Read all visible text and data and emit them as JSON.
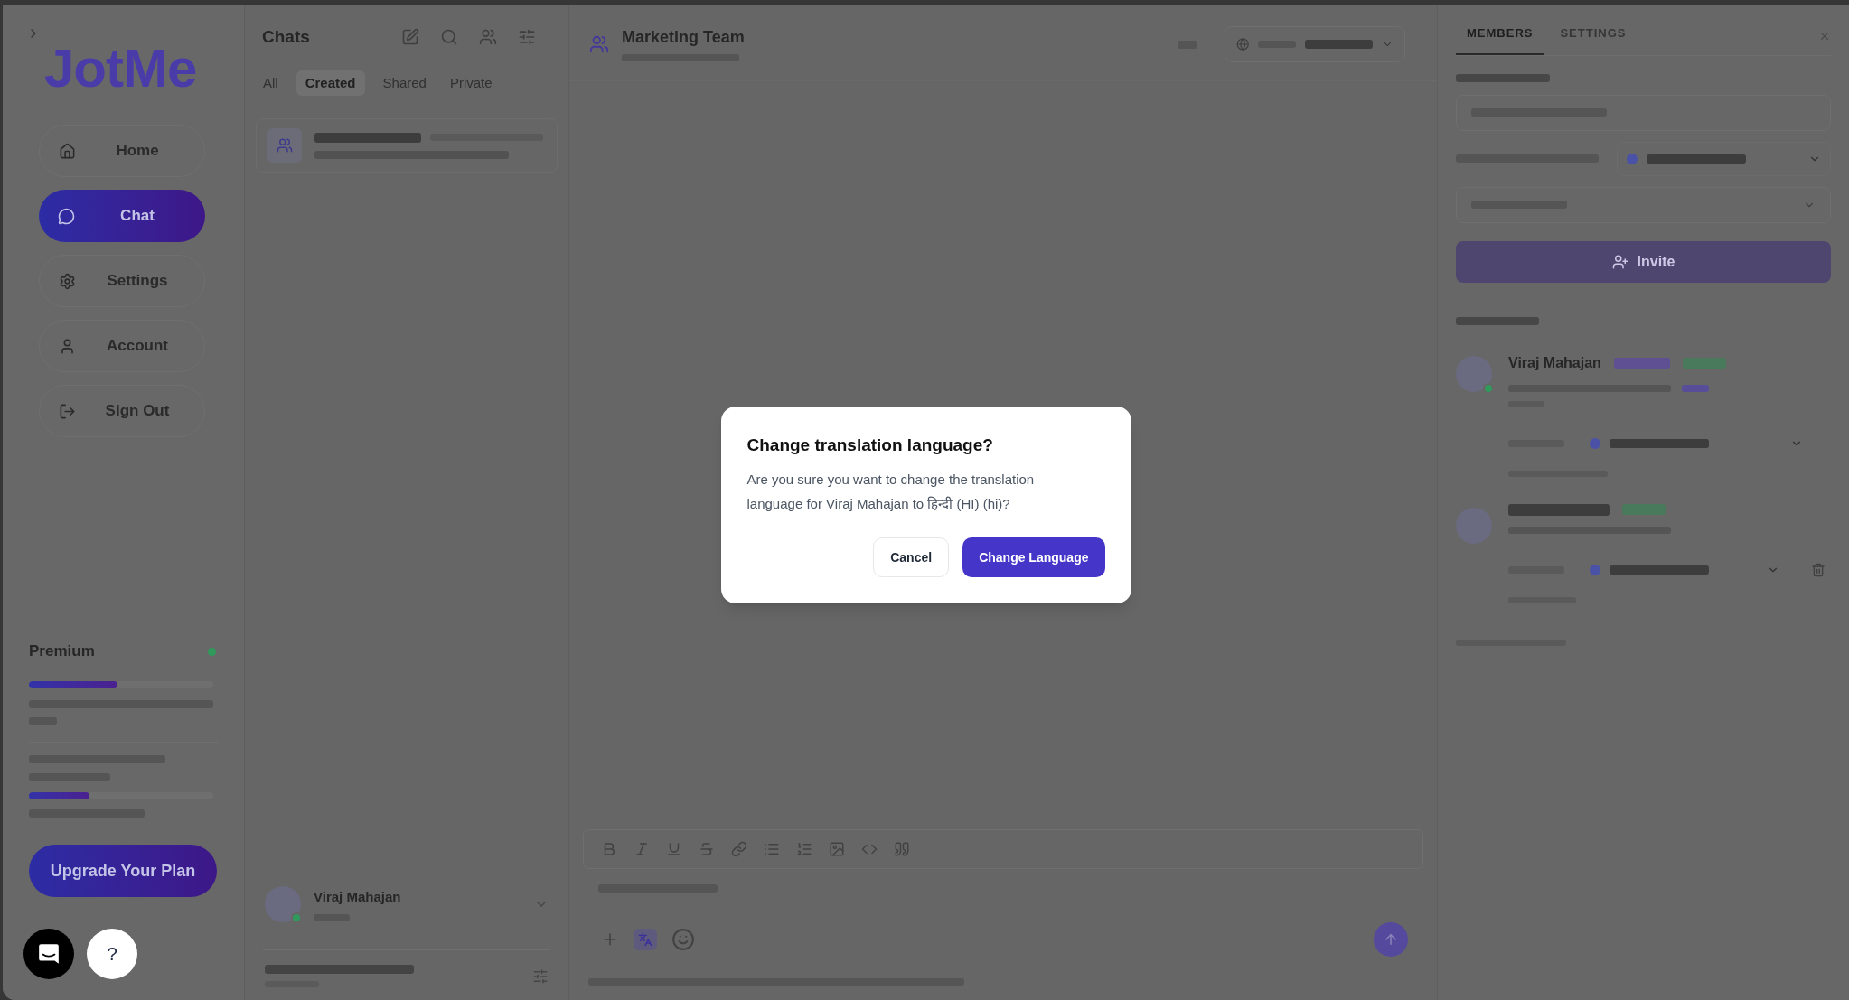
{
  "sidebar": {
    "logo": "JotMe",
    "nav": [
      {
        "label": "Home",
        "selected": false
      },
      {
        "label": "Chat",
        "selected": true
      },
      {
        "label": "Settings",
        "selected": false
      },
      {
        "label": "Account",
        "selected": false
      },
      {
        "label": "Sign Out",
        "selected": false
      }
    ],
    "plan": {
      "title": "Premium",
      "meters": [
        {
          "level": 0.48
        },
        {
          "level": 0.33
        }
      ],
      "upgrade_button": "Upgrade Your Plan"
    }
  },
  "chat_list": {
    "title": "Chats",
    "tabs": [
      {
        "label": "All",
        "selected": false
      },
      {
        "label": "Created",
        "selected": true
      },
      {
        "label": "Shared",
        "selected": false
      },
      {
        "label": "Private",
        "selected": false
      }
    ],
    "profile": {
      "name": "Viraj Mahajan"
    }
  },
  "conversation": {
    "title": "Marketing Team"
  },
  "members_panel": {
    "tabs": [
      {
        "label": "MEMBERS",
        "selected": true
      },
      {
        "label": "SETTINGS",
        "selected": false
      }
    ],
    "invite_button": "Invite",
    "members": [
      {
        "name": "Viraj Mahajan"
      }
    ]
  },
  "dialog": {
    "title": "Change translation language?",
    "message": "Are you sure you want to change the translation language for Viraj Mahajan to हिन्दी (HI) (hi)?",
    "buttons": [
      {
        "label": "Cancel",
        "kind": "secondary"
      },
      {
        "label": "Change Language",
        "kind": "primary"
      }
    ]
  },
  "help_button": "?"
}
